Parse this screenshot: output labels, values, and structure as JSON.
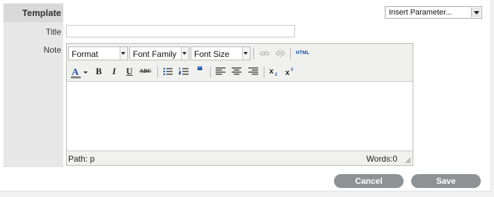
{
  "form": {
    "section_title": "Template",
    "title_label": "Title",
    "note_label": "Note",
    "title_value": "",
    "insert_parameter": "Insert Parameter..."
  },
  "editor": {
    "format": "Format",
    "font_family": "Font Family",
    "font_size": "Font Size",
    "html_label": "HTML",
    "bold": "B",
    "italic": "I",
    "underline": "U",
    "strike": "ABC",
    "path": "Path: p",
    "words": "Words:0",
    "content": ""
  },
  "buttons": {
    "cancel": "Cancel",
    "save": "Save"
  },
  "colors": {
    "button_bg": "#8e9294",
    "accent_blue": "#1f56a6",
    "font_color_underline": "#808080"
  }
}
